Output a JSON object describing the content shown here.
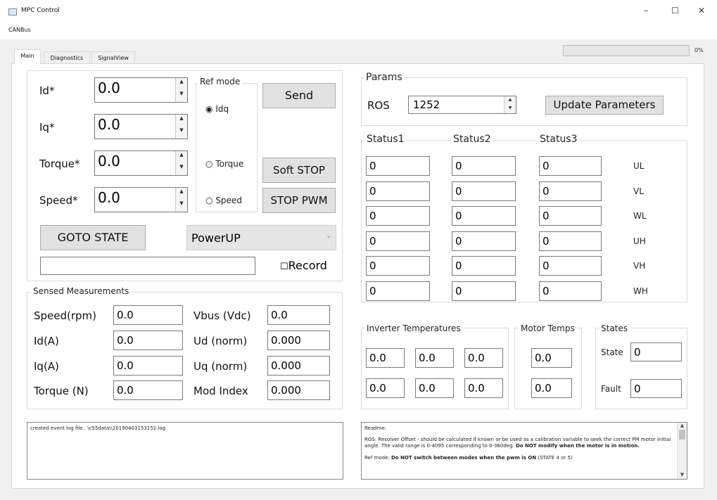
{
  "window": {
    "title": "MPC Control",
    "minimize_icon": "–",
    "maximize_icon": "☐",
    "close_icon": "✕"
  },
  "menu": {
    "canbus": "CANBus"
  },
  "tabs": [
    "Main",
    "Diagnostics",
    "SignalView"
  ],
  "progress": {
    "label": "0%",
    "value": 0
  },
  "setpoints": {
    "id_label": "Id*",
    "id_value": "0.0",
    "iq_label": "Iq*",
    "iq_value": "0.0",
    "torque_label": "Torque*",
    "torque_value": "0.0",
    "speed_label": "Speed*",
    "speed_value": "0.0"
  },
  "refmode": {
    "title": "Ref mode",
    "idq": "Idq",
    "torque": "Torque",
    "speed": "Speed",
    "selected": "Idq"
  },
  "buttons": {
    "send": "Send",
    "soft_stop": "Soft STOP",
    "stop_pwm": "STOP PWM",
    "goto_state": "GOTO STATE",
    "update_params": "Update Parameters"
  },
  "state_select": {
    "value": "PowerUP"
  },
  "record": {
    "label": "Record"
  },
  "sensed": {
    "title": "Sensed Measurements",
    "rows": [
      {
        "l1": "Speed(rpm)",
        "v1": "0.0",
        "l2": "Vbus (Vdc)",
        "v2": "0.0"
      },
      {
        "l1": "Id(A)",
        "v1": "0.0",
        "l2": "Ud (norm)",
        "v2": "0.000"
      },
      {
        "l1": "Iq(A)",
        "v1": "0.0",
        "l2": "Uq (norm)",
        "v2": "0.000"
      },
      {
        "l1": "Torque (N)",
        "v1": "0.0",
        "l2": "Mod Index",
        "v2": "0.000"
      }
    ]
  },
  "params": {
    "title": "Params",
    "ros_label": "ROS",
    "ros_value": "1252"
  },
  "status": {
    "headers": [
      "Status1",
      "Status2",
      "Status3"
    ],
    "rows": [
      {
        "v": [
          "0",
          "0",
          "0"
        ],
        "label": "UL"
      },
      {
        "v": [
          "0",
          "0",
          "0"
        ],
        "label": "VL"
      },
      {
        "v": [
          "0",
          "0",
          "0"
        ],
        "label": "WL"
      },
      {
        "v": [
          "0",
          "0",
          "0"
        ],
        "label": "UH"
      },
      {
        "v": [
          "0",
          "0",
          "0"
        ],
        "label": "VH"
      },
      {
        "v": [
          "0",
          "0",
          "0"
        ],
        "label": "WH"
      }
    ]
  },
  "inverter": {
    "title": "Inverter Temperatures",
    "values": [
      "0.0",
      "0.0",
      "0.0",
      "0.0",
      "0.0",
      "0.0"
    ]
  },
  "motor": {
    "title": "Motor Temps",
    "values": [
      "0.0",
      "0.0"
    ]
  },
  "states": {
    "title": "States",
    "state_label": "State",
    "state_value": "0",
    "fault_label": "Fault",
    "fault_value": "0"
  },
  "log": {
    "text": "created event log file . \\c55data\\\\20190403153152.log"
  },
  "readme": {
    "heading": "Readme:",
    "p1_normal": "ROS: Resolver Offset - should be calculated if known or be used as a calibration variable to seek the correct PM motor initial angle. The valid range is 0-4095 corresponding to 0-360deg. ",
    "p1_bold": "Do NOT modify when the motor is in motion.",
    "p2_normal": "Ref mode: ",
    "p2_bold": "Do NOT switch between modes when the pwm is ON",
    "p2_tail": " (STATE 4 or 5)"
  }
}
